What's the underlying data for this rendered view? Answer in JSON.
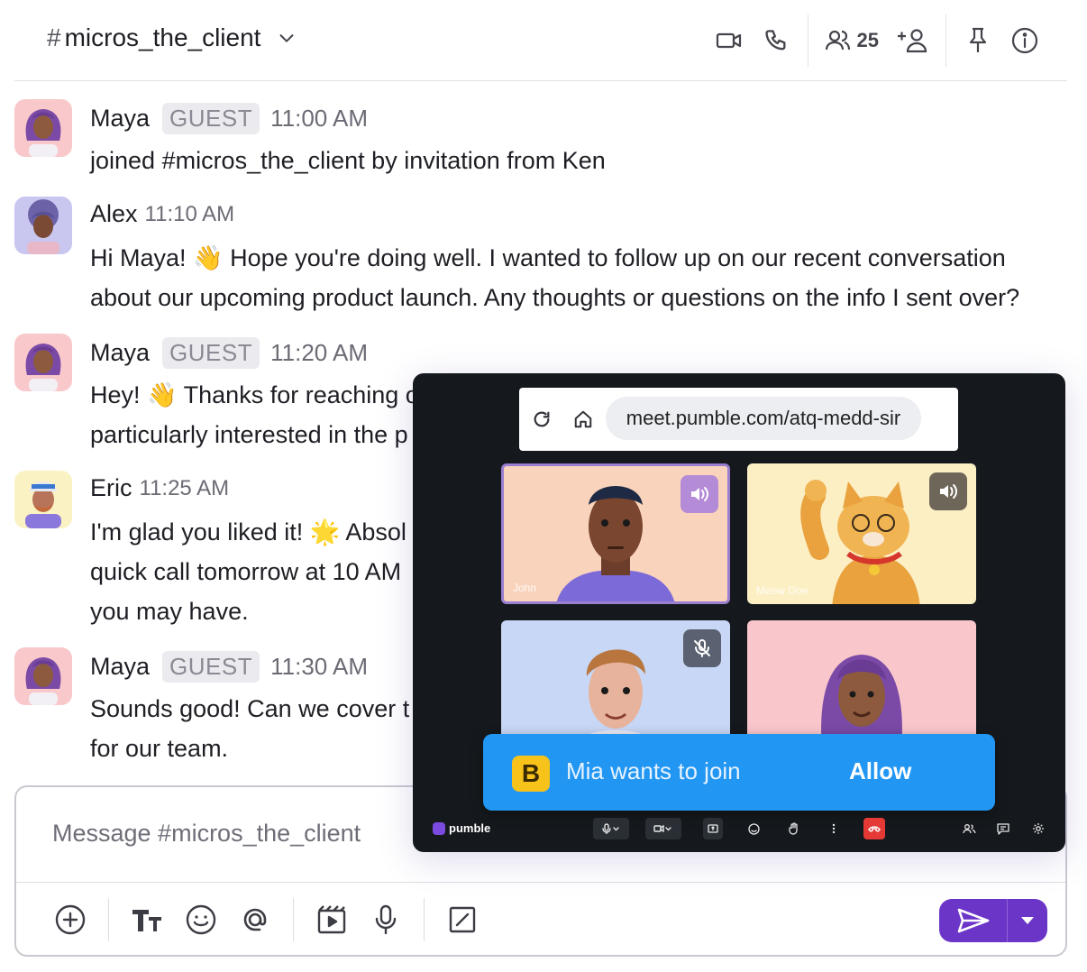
{
  "header": {
    "channel_hash": "#",
    "channel_name": "micros_the_client",
    "member_count": "25"
  },
  "messages": [
    {
      "author": "Maya",
      "badge": "GUEST",
      "time": "11:00 AM",
      "lines": [
        "joined #micros_the_client by invitation from Ken"
      ]
    },
    {
      "author": "Alex",
      "badge": "",
      "time": "11:10 AM",
      "lines": [
        "Hi Maya! 👋 Hope you're doing well. I wanted to follow up on our recent conversation",
        "about our upcoming product launch. Any thoughts or questions on the info I sent over?"
      ]
    },
    {
      "author": "Maya",
      "badge": "GUEST",
      "time": "11:20 AM",
      "lines": [
        "Hey! 👋 Thanks for reaching o",
        "particularly interested in the p"
      ]
    },
    {
      "author": "Eric",
      "badge": "",
      "time": "11:25 AM",
      "lines": [
        "I'm glad you liked it! 🌟 Absol",
        "quick call tomorrow at 10 AM",
        "you may have."
      ]
    },
    {
      "author": "Maya",
      "badge": "GUEST",
      "time": "11:30 AM",
      "lines": [
        "Sounds good! Can we cover t",
        "for our team."
      ]
    }
  ],
  "composer": {
    "placeholder": "Message #micros_the_client"
  },
  "meeting": {
    "url": "meet.pumble.com/atq-medd-sir",
    "tiles": [
      {
        "name": "John",
        "audio": "speaker"
      },
      {
        "name": "Meow Doe",
        "audio": "speaker"
      },
      {
        "name": "",
        "audio": "muted"
      },
      {
        "name": "",
        "audio": "none"
      }
    ],
    "join_request": {
      "logo_letter": "B",
      "text": "Mia wants to join",
      "action": "Allow"
    },
    "brand": "pumble"
  },
  "colors": {
    "accent": "#6b35c8",
    "banner": "#2196f3",
    "end_call": "#e53935",
    "meeting_bg": "#15191d"
  },
  "icons": {
    "header": [
      "video-camera-icon",
      "phone-icon",
      "members-icon",
      "add-member-icon",
      "pin-icon",
      "info-icon"
    ],
    "composer": [
      "plus-circle-icon",
      "text-format-icon",
      "emoji-icon",
      "mention-icon",
      "video-clip-icon",
      "microphone-icon",
      "slash-command-icon",
      "send-icon",
      "caret-down-icon"
    ]
  }
}
